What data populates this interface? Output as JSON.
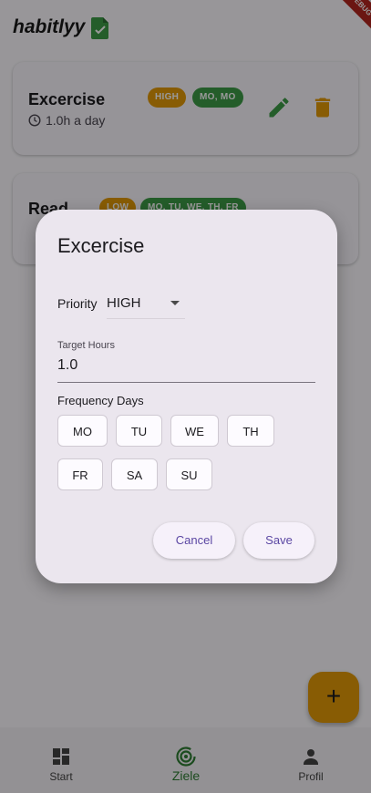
{
  "app": {
    "title": "habitlyy",
    "debug_banner": "DEBUG"
  },
  "habits": [
    {
      "name": "Excercise",
      "duration": "1.0h a day",
      "priority": "HIGH",
      "days": "MO, MO"
    },
    {
      "name": "Read",
      "priority": "LOW",
      "days": "MO, TU, WE, TH, FR"
    }
  ],
  "dialog": {
    "title": "Excercise",
    "priority_label": "Priority",
    "priority_value": "HIGH",
    "target_hours_label": "Target Hours",
    "target_hours_value": "1.0",
    "frequency_label": "Frequency Days",
    "days": [
      "MO",
      "TU",
      "WE",
      "TH",
      "FR",
      "SA",
      "SU"
    ],
    "cancel_label": "Cancel",
    "save_label": "Save"
  },
  "fab": {
    "icon": "plus-icon",
    "label": "+"
  },
  "bottom_nav": [
    {
      "label": "Start",
      "icon": "dashboard-icon"
    },
    {
      "label": "Ziele",
      "icon": "target-icon"
    },
    {
      "label": "Profil",
      "icon": "person-icon"
    }
  ],
  "colors": {
    "accent_orange": "#e39a08",
    "accent_green": "#3d9b46",
    "primary_text_button": "#5b47a3"
  }
}
